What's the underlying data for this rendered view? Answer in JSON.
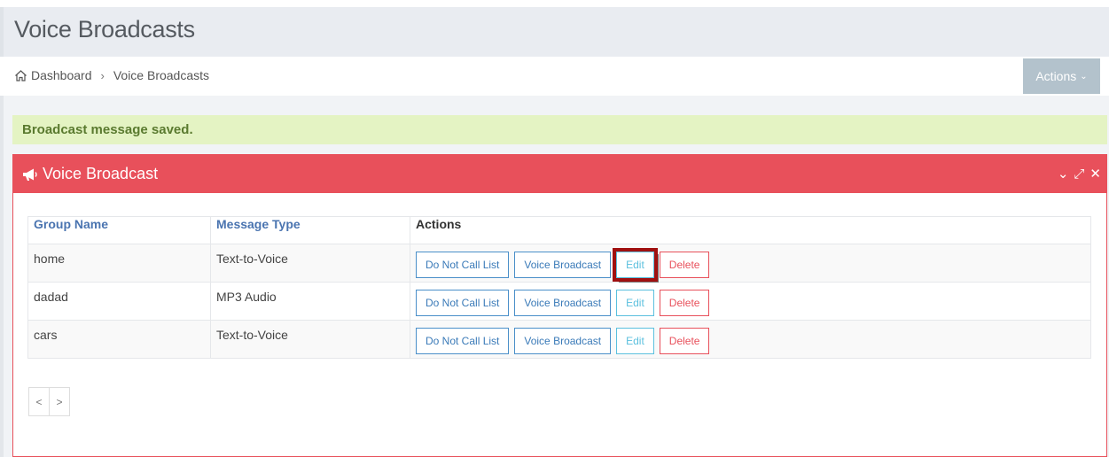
{
  "page": {
    "title": "Voice Broadcasts"
  },
  "breadcrumb": {
    "home": "Dashboard",
    "separator": "›",
    "current": "Voice Broadcasts"
  },
  "header": {
    "actions_label": "Actions",
    "actions_chevron": "⌄"
  },
  "alert": {
    "text": "Broadcast message saved."
  },
  "panel": {
    "title": "Voice Broadcast",
    "icon": "megaphone-icon",
    "tools": {
      "collapse": "⌄",
      "expand": "⤢",
      "close": "✕"
    },
    "accent": "#e8505b"
  },
  "table": {
    "headers": [
      "Group Name",
      "Message Type",
      "Actions"
    ],
    "rows": [
      {
        "group": "home",
        "type": "Text-to-Voice"
      },
      {
        "group": "dadad",
        "type": "MP3 Audio"
      },
      {
        "group": "cars",
        "type": "Text-to-Voice"
      }
    ],
    "buttons": {
      "dnc": "Do Not Call List",
      "broadcast": "Voice Broadcast",
      "edit": "Edit",
      "delete": "Delete"
    }
  },
  "pager": {
    "prev": "<",
    "next": ">"
  }
}
